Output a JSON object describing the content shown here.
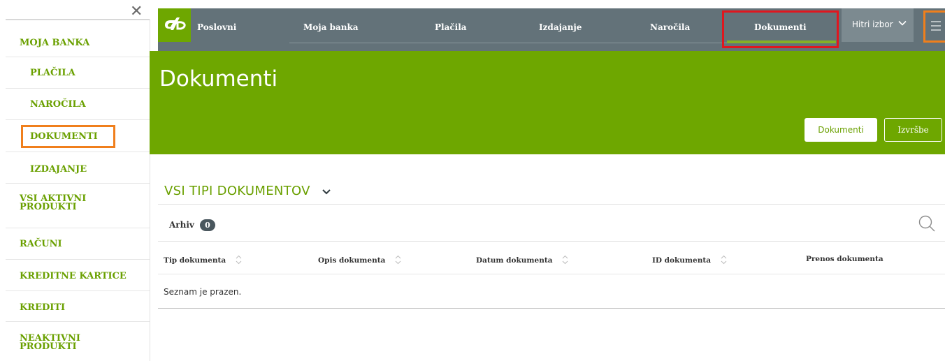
{
  "sidebar": {
    "items": [
      {
        "label": "MOJA BANKA"
      },
      {
        "label": "PLAČILA"
      },
      {
        "label": "NAROČILA"
      },
      {
        "label": "DOKUMENTI"
      },
      {
        "label": "IZDAJANJE"
      },
      {
        "label": "VSI AKTIVNI PRODUKTI"
      },
      {
        "label": "RAČUNI"
      },
      {
        "label": "KREDITNE KARTICE"
      },
      {
        "label": "KREDITI"
      },
      {
        "label": "NEAKTIVNI PRODUKTI"
      }
    ],
    "close_icon": "close-icon"
  },
  "header": {
    "brand": "Poslovni",
    "nav": [
      "Moja banka",
      "Plačila",
      "Izdajanje",
      "Naročila",
      "Dokumenti"
    ],
    "active": "Dokumenti",
    "quick_select": "Hitri izbor",
    "menu_icon": "hamburger-icon"
  },
  "banner": {
    "title": "Dokumenti",
    "btn_documents": "Dokumenti",
    "btn_executions": "Izvršbe"
  },
  "content": {
    "doc_type_filter": "VSI TIPI DOKUMENTOV",
    "archive_label": "Arhiv",
    "archive_count": "0",
    "columns": [
      "Tip dokumenta",
      "Opis dokumenta",
      "Datum dokumenta",
      "ID dokumenta",
      "Prenos dokumenta"
    ],
    "empty_text": "Seznam je prazen."
  },
  "colors": {
    "brand_green": "#6ea700",
    "header_gray": "#637279",
    "highlight_red": "#e0161e",
    "highlight_orange": "#f07f1c"
  }
}
